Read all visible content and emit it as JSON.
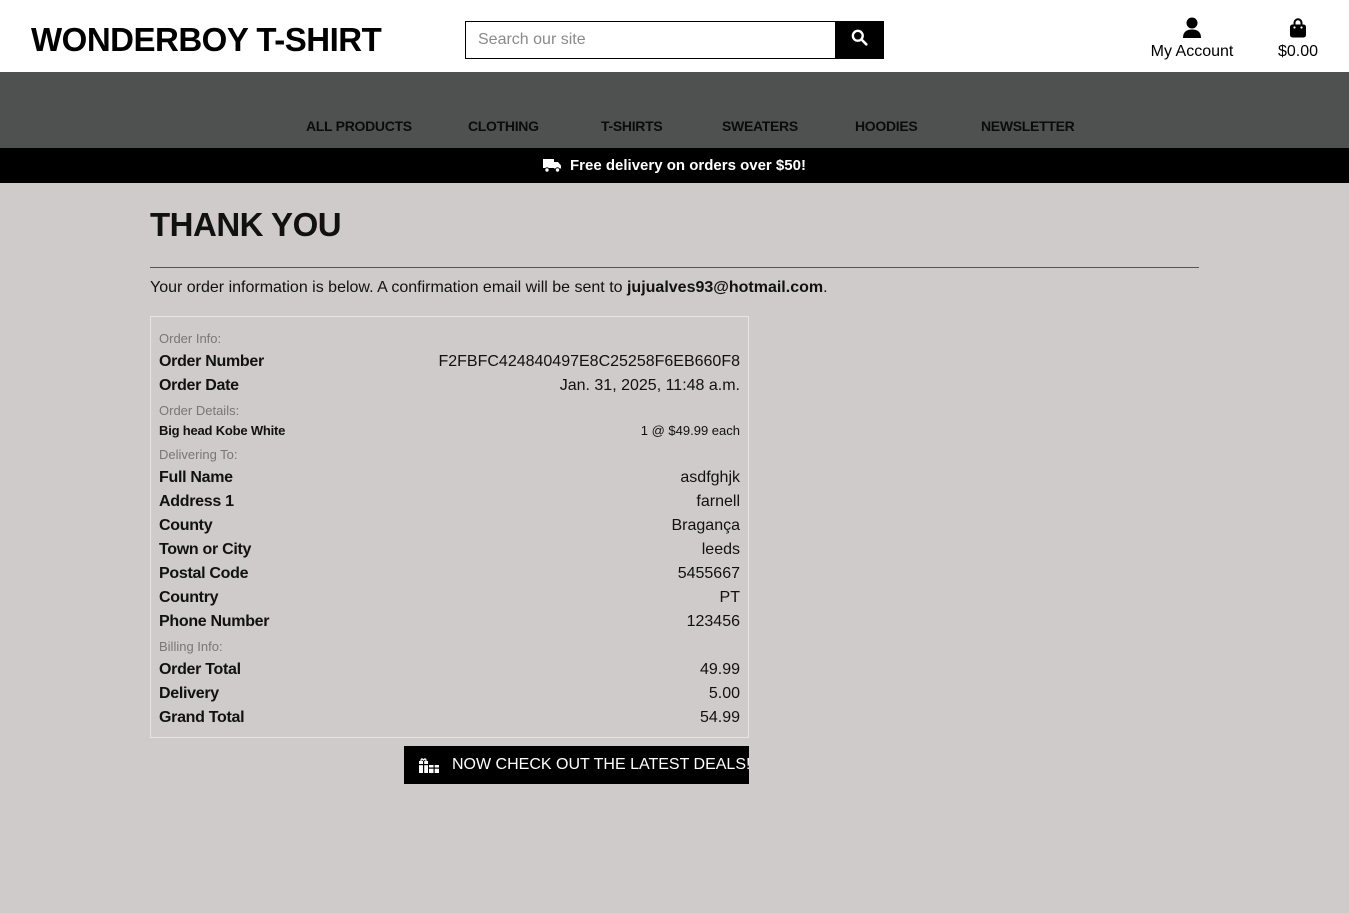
{
  "header": {
    "brand": "WONDERBOY T-SHIRT",
    "search_placeholder": "Search our site",
    "account_label": "My Account",
    "bag_total": "$0.00"
  },
  "nav": {
    "items": [
      "ALL PRODUCTS",
      "CLOTHING",
      "T-SHIRTS",
      "SWEATERS",
      "HOODIES",
      "NEWSLETTER"
    ]
  },
  "promo": {
    "text": "Free delivery on orders over $50!"
  },
  "page": {
    "title": "THANK YOU",
    "intro_text": "Your order information is below. A confirmation email will be sent to ",
    "email": "jujualves93@hotmail.com",
    "intro_end": "."
  },
  "order": {
    "info_heading": "Order Info:",
    "order_number_label": "Order Number",
    "order_number": "F2FBFC424840497E8C25258F6EB660F8",
    "order_date_label": "Order Date",
    "order_date": "Jan. 31, 2025, 11:48 a.m.",
    "details_heading": "Order Details:",
    "item_name": "Big head Kobe White",
    "item_qty": "1 @ $49.99 each",
    "delivering_heading": "Delivering To:",
    "full_name_label": "Full Name",
    "full_name": "asdfghjk",
    "address1_label": "Address 1",
    "address1": "farnell",
    "county_label": "County",
    "county": "Bragança",
    "town_label": "Town or City",
    "town": "leeds",
    "postal_label": "Postal Code",
    "postal": "5455667",
    "country_label": "Country",
    "country": "PT",
    "phone_label": "Phone Number",
    "phone": "123456",
    "billing_heading": "Billing Info:",
    "order_total_label": "Order Total",
    "order_total": "49.99",
    "delivery_label": "Delivery",
    "delivery": "5.00",
    "grand_total_label": "Grand Total",
    "grand_total": "54.99"
  },
  "cta": {
    "label": "NOW CHECK OUT THE LATEST DEALS!"
  },
  "icons": {
    "search": "search-icon",
    "account": "user-icon",
    "bag": "shopping-bag-icon",
    "truck": "truck-icon",
    "deals": "gifts-icon"
  }
}
